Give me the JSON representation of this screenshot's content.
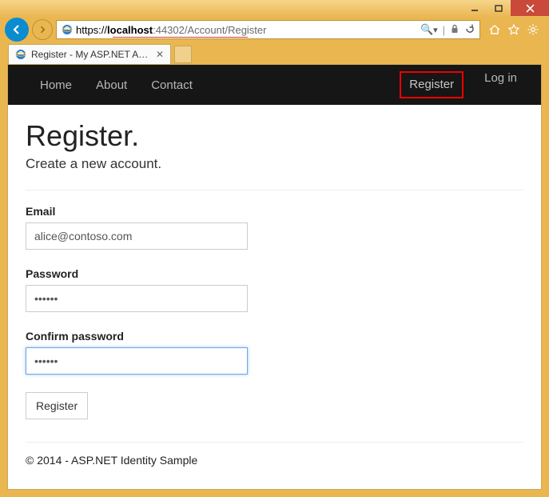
{
  "window": {
    "url_scheme": "https://",
    "url_host": "localhost",
    "url_port": ":44302",
    "url_path": "/Account/Register",
    "search_placeholder": "",
    "tab_title": "Register - My ASP.NET App..."
  },
  "nav": {
    "left": {
      "home": "Home",
      "about": "About",
      "contact": "Contact"
    },
    "right": {
      "register": "Register",
      "login": "Log in"
    }
  },
  "page": {
    "heading": "Register.",
    "subtitle": "Create a new account.",
    "labels": {
      "email": "Email",
      "password": "Password",
      "confirm": "Confirm password"
    },
    "values": {
      "email": "alice@contoso.com",
      "password": "••••••",
      "confirm": "••••••"
    },
    "submit": "Register",
    "footer": "© 2014 - ASP.NET Identity Sample"
  }
}
